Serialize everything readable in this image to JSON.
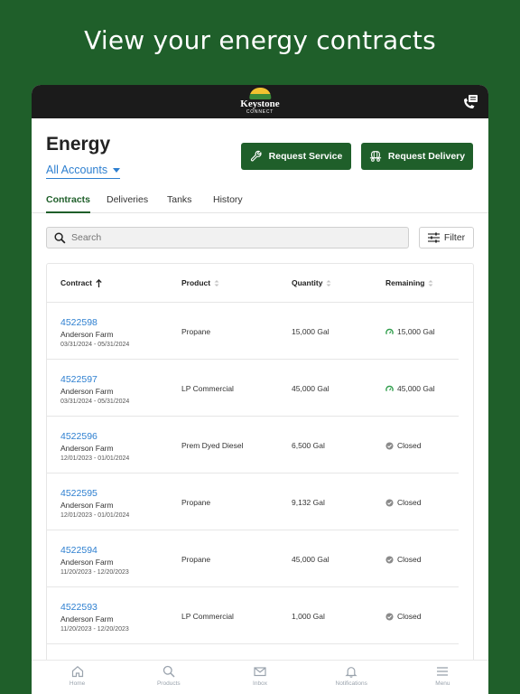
{
  "headline": "View your energy contracts",
  "brand": {
    "name": "Keystone",
    "sub": "CONNECT"
  },
  "page": {
    "title": "Energy",
    "account_selector": "All Accounts"
  },
  "actions": {
    "request_service": "Request Service",
    "request_delivery": "Request Delivery"
  },
  "tabs": [
    {
      "label": "Contracts",
      "active": true
    },
    {
      "label": "Deliveries",
      "active": false
    },
    {
      "label": "Tanks",
      "active": false
    },
    {
      "label": "History",
      "active": false
    }
  ],
  "search": {
    "placeholder": "Search"
  },
  "filter": {
    "label": "Filter"
  },
  "table": {
    "headers": {
      "contract": "Contract",
      "product": "Product",
      "quantity": "Quantity",
      "remaining": "Remaining"
    },
    "rows": [
      {
        "contract": "4522598",
        "farm": "Anderson Farm",
        "dates": "03/31/2024 - 05/31/2024",
        "product": "Propane",
        "quantity": "15,000 Gal",
        "remaining": "15,000 Gal",
        "status": "gauge"
      },
      {
        "contract": "4522597",
        "farm": "Anderson Farm",
        "dates": "03/31/2024 - 05/31/2024",
        "product": "LP Commercial",
        "quantity": "45,000 Gal",
        "remaining": "45,000 Gal",
        "status": "gauge"
      },
      {
        "contract": "4522596",
        "farm": "Anderson Farm",
        "dates": "12/01/2023 - 01/01/2024",
        "product": "Prem Dyed Diesel",
        "quantity": "6,500 Gal",
        "remaining": "Closed",
        "status": "closed"
      },
      {
        "contract": "4522595",
        "farm": "Anderson Farm",
        "dates": "12/01/2023 - 01/01/2024",
        "product": "Propane",
        "quantity": "9,132 Gal",
        "remaining": "Closed",
        "status": "closed"
      },
      {
        "contract": "4522594",
        "farm": "Anderson Farm",
        "dates": "11/20/2023 - 12/20/2023",
        "product": "Propane",
        "quantity": "45,000 Gal",
        "remaining": "Closed",
        "status": "closed"
      },
      {
        "contract": "4522593",
        "farm": "Anderson Farm",
        "dates": "11/20/2023 - 12/20/2023",
        "product": "LP Commercial",
        "quantity": "1,000 Gal",
        "remaining": "Closed",
        "status": "closed"
      }
    ]
  },
  "bottom_nav": [
    {
      "label": "Home",
      "icon": "home-icon"
    },
    {
      "label": "Products",
      "icon": "search-icon"
    },
    {
      "label": "Inbox",
      "icon": "mail-icon"
    },
    {
      "label": "Notifications",
      "icon": "bell-icon"
    },
    {
      "label": "Menu",
      "icon": "menu-icon"
    }
  ],
  "colors": {
    "brand_green": "#1f5f2a",
    "link_blue": "#2d7fd0",
    "gauge_green": "#2e9d4a",
    "closed_gray": "#8a8a8a"
  }
}
